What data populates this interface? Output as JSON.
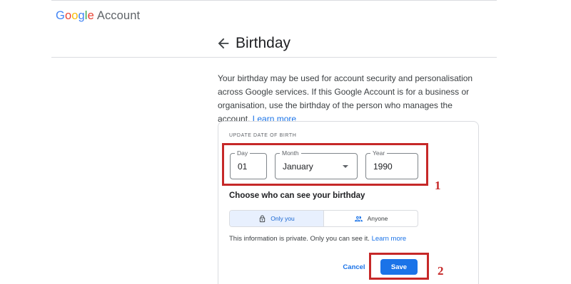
{
  "header": {
    "logo": {
      "letters": [
        "G",
        "o",
        "o",
        "g",
        "l",
        "e"
      ],
      "product": "Account"
    }
  },
  "page": {
    "back_icon": "arrow-left-icon",
    "title": "Birthday"
  },
  "description": {
    "text": "Your birthday may be used for account security and personalisation across Google services. If this Google Account is for a business or organisation, use the birthday of the person who manages the account. ",
    "link": "Learn more"
  },
  "card": {
    "section_label": "UPDATE DATE OF BIRTH",
    "day": {
      "label": "Day",
      "value": "01"
    },
    "month": {
      "label": "Month",
      "value": "January"
    },
    "year": {
      "label": "Year",
      "value": "1990"
    },
    "visibility_title": "Choose who can see your birthday",
    "visibility_options": [
      {
        "label": "Only you",
        "icon": "lock-icon",
        "selected": true
      },
      {
        "label": "Anyone",
        "icon": "people-icon",
        "selected": false
      }
    ],
    "private_note": "This information is private. Only you can see it. ",
    "private_link": "Learn more",
    "cancel_label": "Cancel",
    "save_label": "Save"
  },
  "annotations": {
    "marker_1": "1",
    "marker_2": "2"
  },
  "colors": {
    "google_blue": "#4285F4",
    "google_red": "#EA4335",
    "google_yellow": "#FBBC05",
    "google_green": "#34A853",
    "accent": "#1a73e8",
    "highlight": "#c62828",
    "selected_bg": "#e8f0fe"
  }
}
